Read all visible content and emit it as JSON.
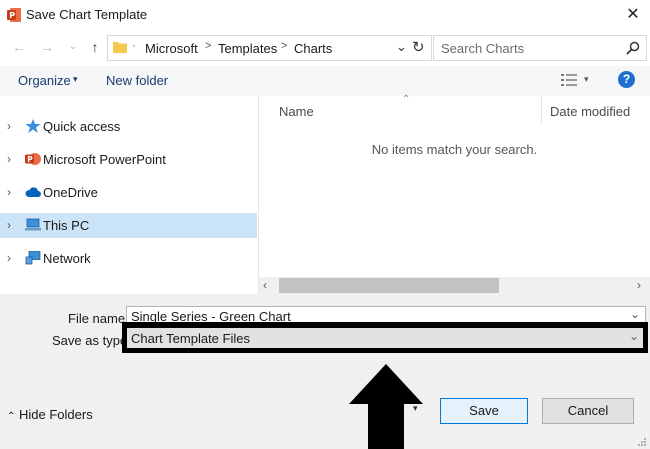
{
  "window": {
    "title": "Save Chart Template"
  },
  "address": {
    "crumbs": [
      "Microsoft",
      "Templates",
      "Charts"
    ],
    "separators": [
      ">",
      ">"
    ],
    "search_placeholder": "Search Charts"
  },
  "toolbar": {
    "organize": "Organize",
    "new_folder": "New folder",
    "help": "?"
  },
  "sidebar": {
    "items": [
      {
        "label": "Quick access"
      },
      {
        "label": "Microsoft PowerPoint"
      },
      {
        "label": "OneDrive"
      },
      {
        "label": "This PC"
      },
      {
        "label": "Network"
      }
    ]
  },
  "filelist": {
    "columns": [
      "Name",
      "Date modified"
    ],
    "empty_message": "No items match your search."
  },
  "form": {
    "filename_label": "File name:",
    "filename_value": "Single Series - Green Chart",
    "saveas_label": "Save as type:",
    "saveas_value": "Chart Template Files"
  },
  "footer": {
    "hide_folders": "Hide Folders",
    "save": "Save",
    "cancel": "Cancel"
  },
  "colors": {
    "accent": "#0078d7",
    "selected_bg": "#cce4f7",
    "help_blue": "#1e6fd0",
    "powerpoint_red": "#c43e1c"
  }
}
